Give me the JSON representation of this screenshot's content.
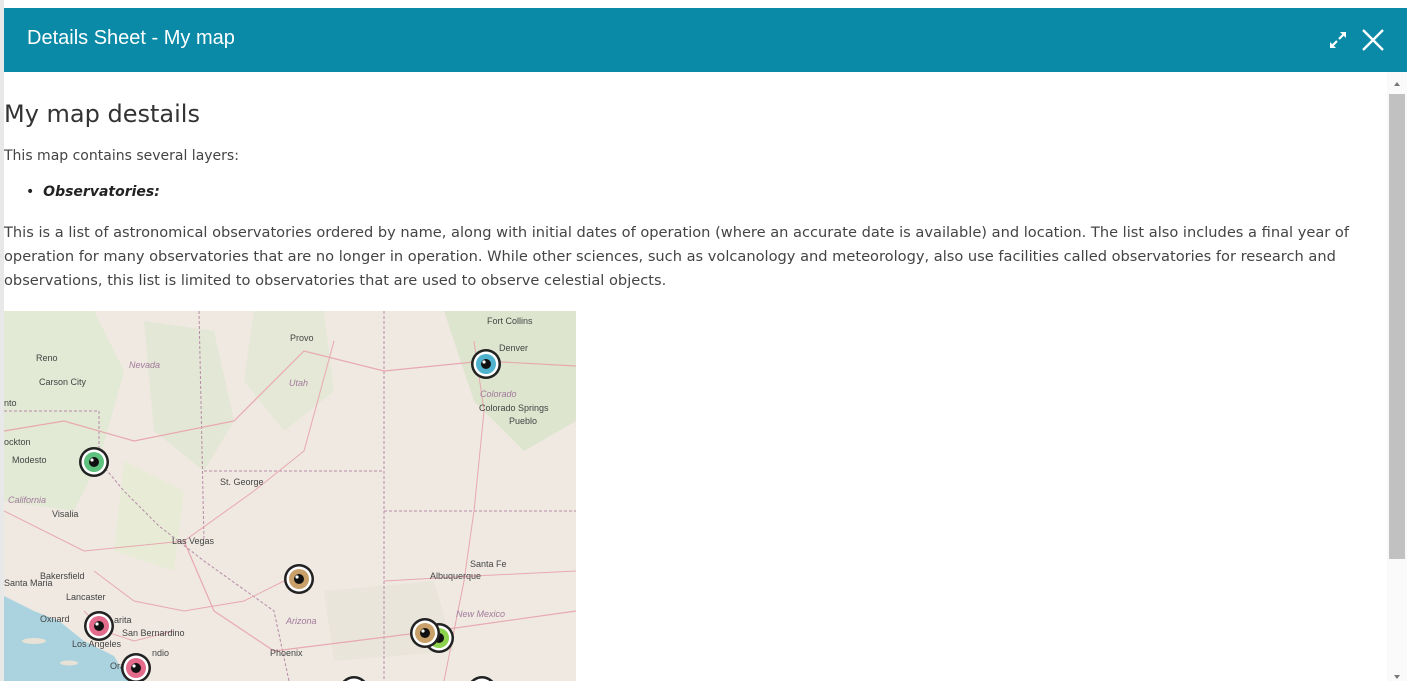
{
  "window": {
    "title": "Details Sheet - My map",
    "accent_color": "#0a8aa7",
    "expand_icon": "expand-arrows-icon",
    "close_icon": "close-icon"
  },
  "details": {
    "heading": "My map destails",
    "intro": "This map contains several layers:",
    "layers": [
      "Observatories:"
    ],
    "description": "This is a list of astronomical observatories ordered by name, along with initial dates of operation (where an accurate date is available) and location. The list also includes a final year of operation for many observatories that are no longer in operation. While other sciences, such as volcanology and meteorology, also use facilities called observatories for research and observations, this list is limited to observatories that are used to observe celestial objects."
  },
  "map": {
    "cities": [
      "Fort Collins",
      "Denver",
      "Provo",
      "Reno",
      "Carson City",
      "Colorado Springs",
      "Pueblo",
      "Stockton",
      "Modesto",
      "St. George",
      "Visalia",
      "Las Vegas",
      "Bakersfield",
      "Santa Maria",
      "Lancaster",
      "Oxnard",
      "San Bernardino",
      "Los Angeles",
      "Phoenix",
      "Santa Fe",
      "Albuquerque"
    ],
    "city_fragments": {
      "sacramento": "nto",
      "stockton": "ockton",
      "santa_clarita": "arita",
      "indio": "ndio",
      "orange": "Ora"
    },
    "states": [
      "Nevada",
      "Utah",
      "Colorado",
      "California",
      "Arizona",
      "New Mexico"
    ],
    "marker_colors": {
      "teal": "#4fb3cf",
      "green": "#5ec27e",
      "tan": "#c9a06a",
      "pink": "#e46b8c",
      "lime": "#8ed34e"
    }
  }
}
